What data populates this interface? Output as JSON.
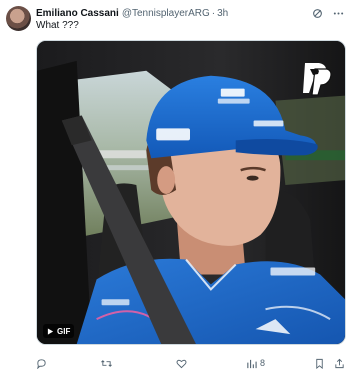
{
  "tweet": {
    "author": {
      "display_name": "Emiliano Cassani",
      "handle": "@TennisplayerARG",
      "separator": "·",
      "time": "3h"
    },
    "text": "What ???",
    "media": {
      "badge": "GIF",
      "icons": [
        "play-icon",
        "pp-logo-icon"
      ]
    },
    "actions": {
      "reply_count": "",
      "retweet_count": "",
      "like_count": "",
      "views_count": "8"
    },
    "header_icons": [
      "grok-icon",
      "more-icon"
    ],
    "colors": {
      "accent": "#1d9bf0",
      "secondary_text": "#536471",
      "jersey_blue": "#1a66c9"
    }
  }
}
